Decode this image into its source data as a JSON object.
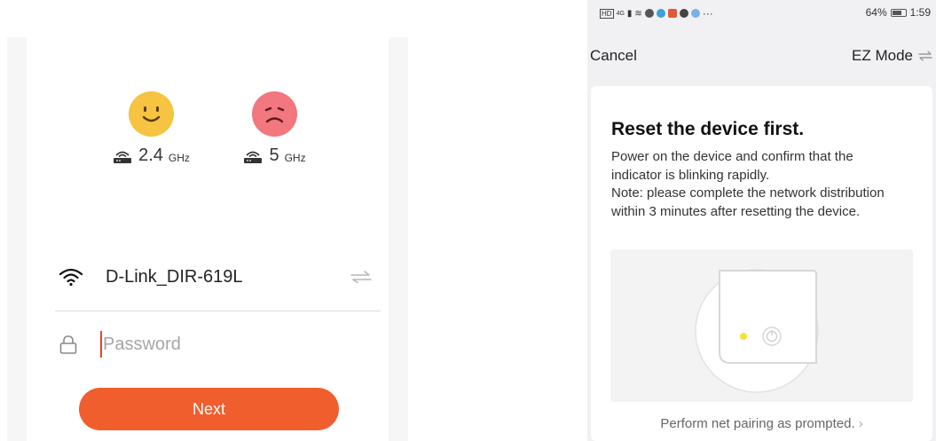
{
  "left_screen": {
    "bands": [
      {
        "face": "happy-face-icon",
        "value": "2.4",
        "unit": "GHz",
        "supported": true,
        "face_color": "#f6c342"
      },
      {
        "face": "sad-face-icon",
        "value": "5",
        "unit": "GHz",
        "supported": false,
        "face_color": "#f2777f"
      }
    ],
    "network": {
      "ssid": "D-Link_DIR-619L",
      "icon": "wifi-icon",
      "switch_icon": "swap-arrows-icon"
    },
    "password": {
      "placeholder": "Password",
      "value": "",
      "icon": "lock-icon"
    },
    "next_label": "Next",
    "accent_color": "#f15e2e"
  },
  "right_screen": {
    "status_bar": {
      "battery": "64%",
      "time": "1:59",
      "carrier": "HD",
      "signal": "4G"
    },
    "nav": {
      "cancel_label": "Cancel",
      "mode_label": "EZ Mode"
    },
    "title": "Reset the device first.",
    "description": [
      "Power on the device and confirm that the indicator is blinking rapidly.",
      "Note: please complete the network distribution within 3 minutes after resetting the device."
    ],
    "hint_label": "Perform net pairing as prompted.",
    "indicator_color": "#f3e23a"
  }
}
